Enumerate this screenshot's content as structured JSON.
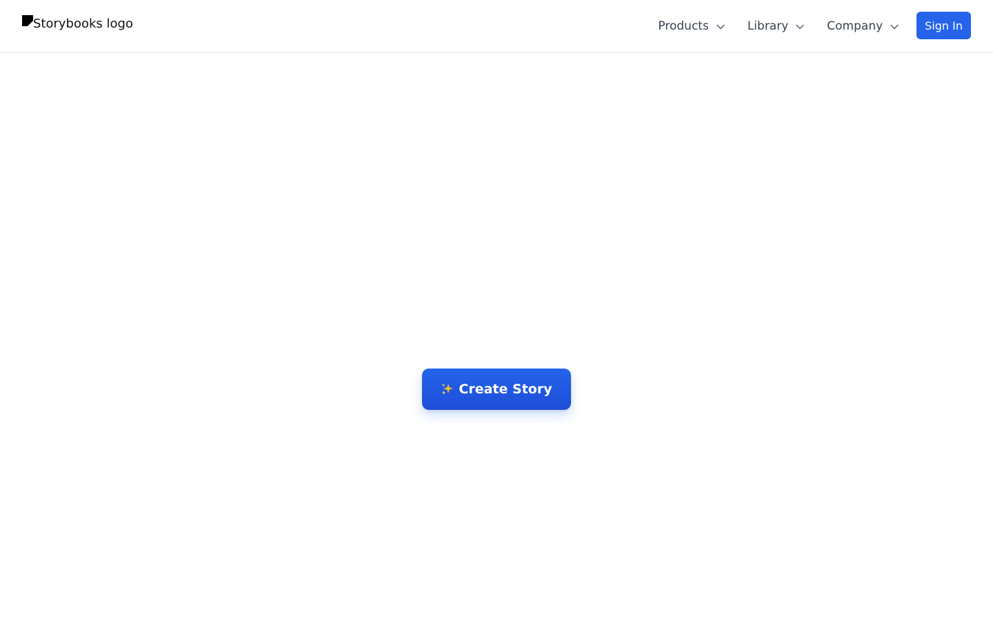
{
  "header": {
    "logo_alt": "Storybooks logo",
    "nav": [
      {
        "label": "Products",
        "icon": "chevron-down-icon"
      },
      {
        "label": "Library",
        "icon": "chevron-down-icon"
      },
      {
        "label": "Company",
        "icon": "chevron-down-icon"
      }
    ],
    "signin_label": "Sign In"
  },
  "main": {
    "cta_icon": "sparkles-icon",
    "cta_label": "Create Story"
  },
  "colors": {
    "accent": "#2563eb",
    "border": "#e5e7eb",
    "sparkle": "#fbbf24"
  }
}
